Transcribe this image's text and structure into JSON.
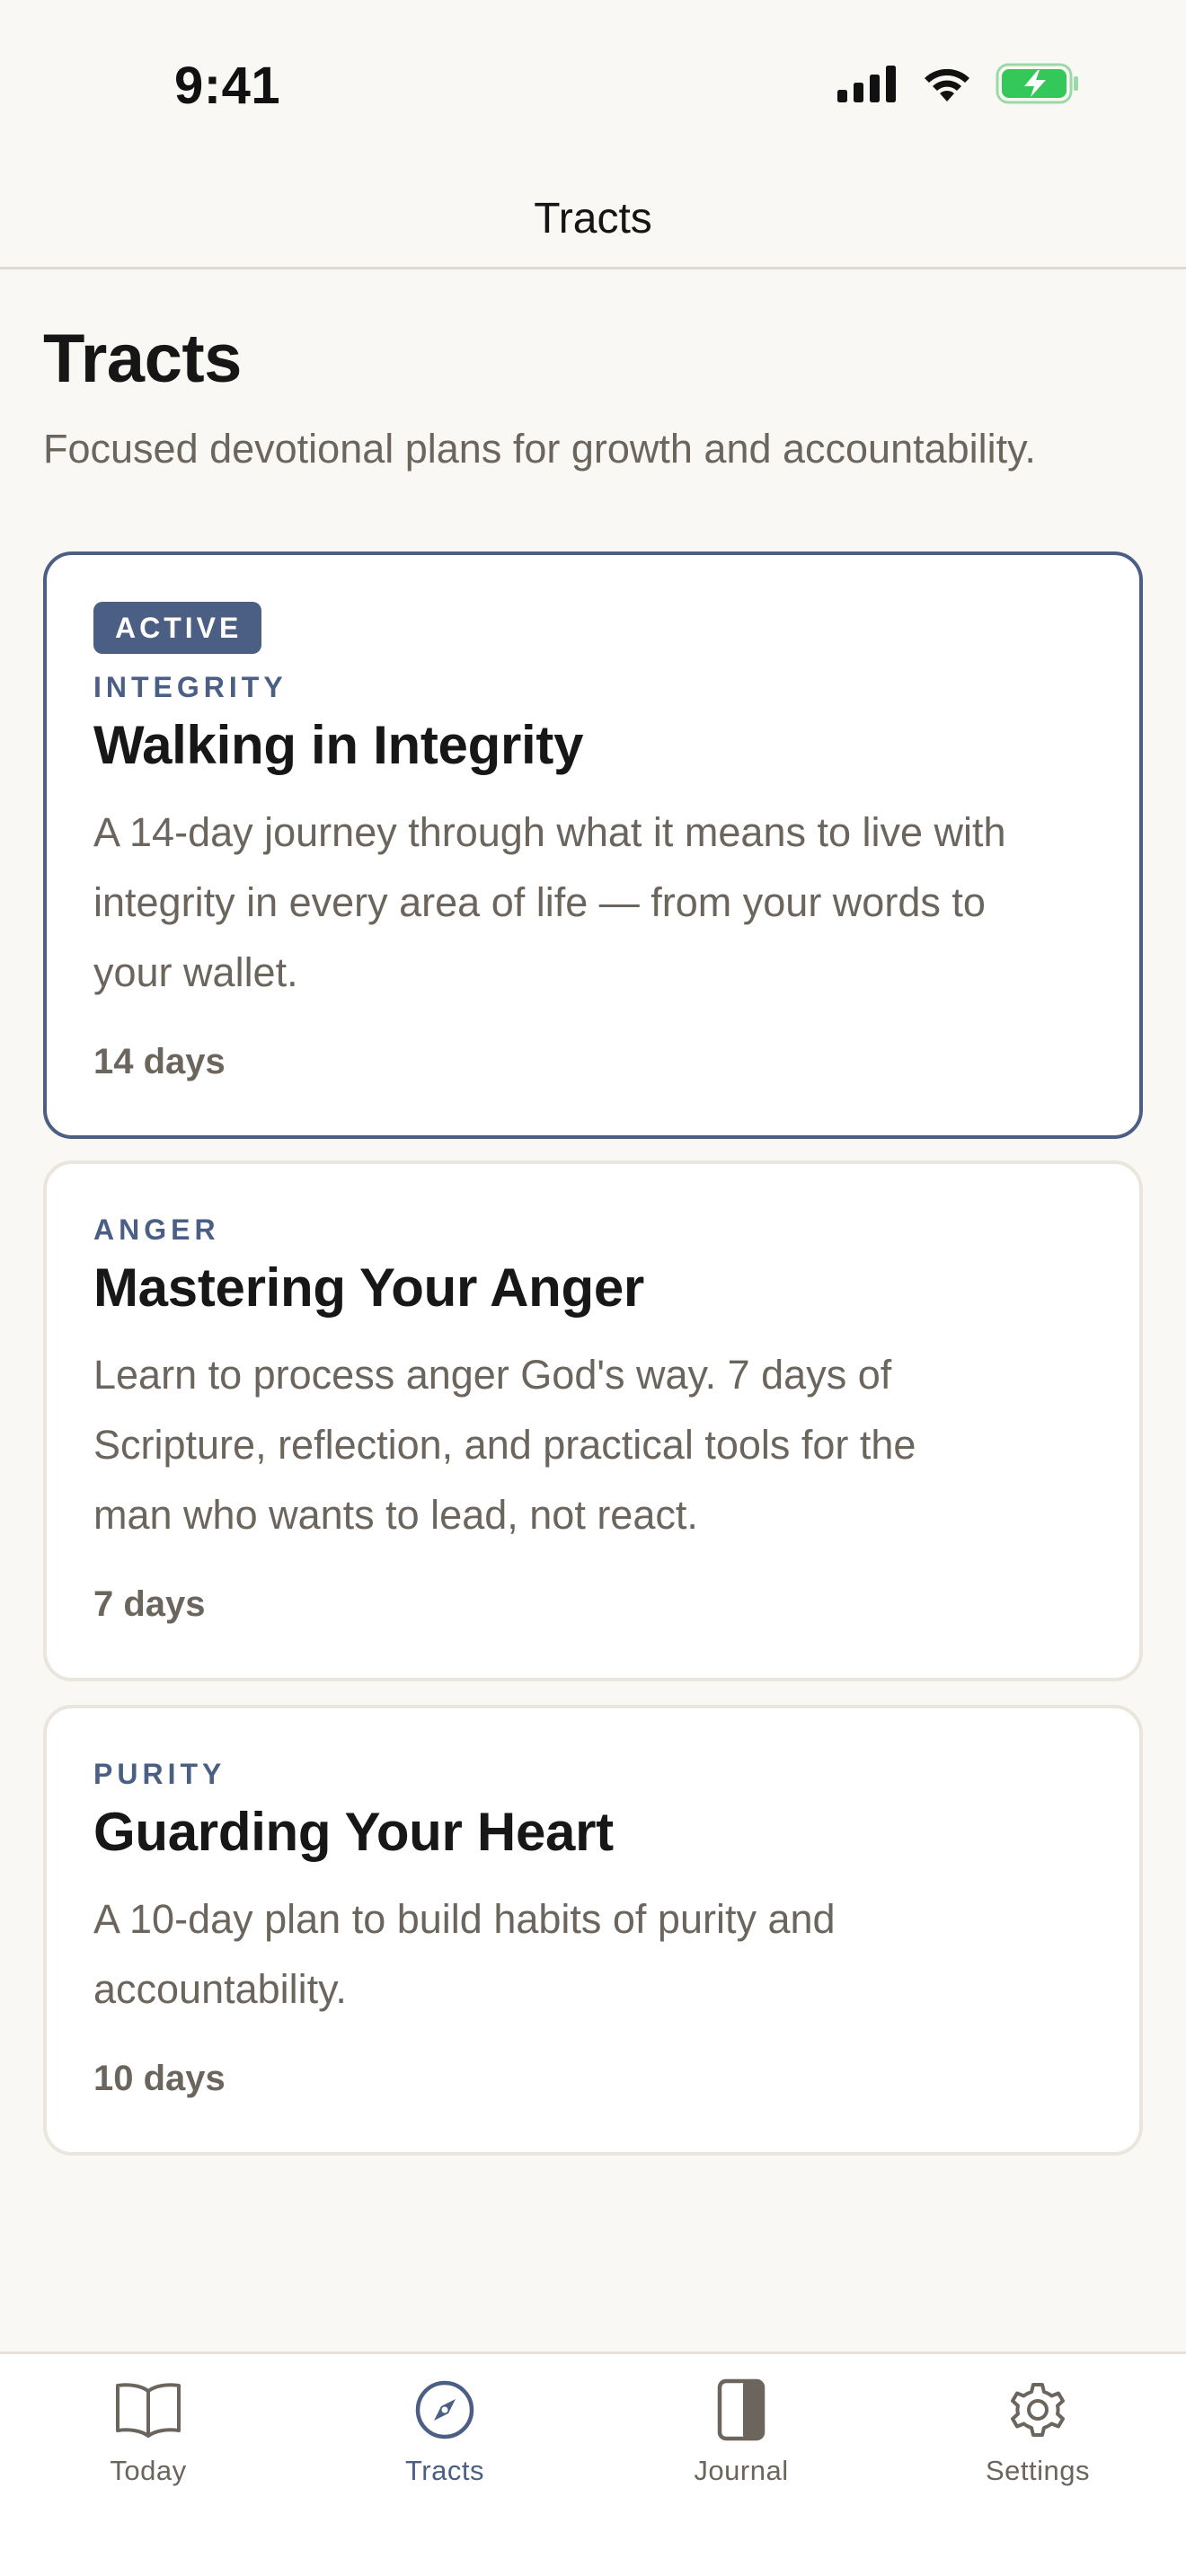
{
  "status_bar": {
    "time": "9:41"
  },
  "nav": {
    "title": "Tracts"
  },
  "header": {
    "title": "Tracts",
    "subtitle": "Focused devotional plans for growth and accountability."
  },
  "tracts": [
    {
      "badge": "ACTIVE",
      "category": "INTEGRITY",
      "title": "Walking in Integrity",
      "description_lines": [
        "A 14-day journey through what it means to live with",
        "integrity in every area of life — from your words to",
        "your wallet."
      ],
      "duration": "14 days"
    },
    {
      "category": "ANGER",
      "title": "Mastering Your Anger",
      "description_lines": [
        "Learn to process anger God's way. 7 days of",
        "Scripture, reflection, and practical tools for the",
        "man who wants to lead, not react."
      ],
      "duration": "7 days"
    },
    {
      "category": "PURITY",
      "title": "Guarding Your Heart",
      "description_lines": [
        "A 10-day plan to build habits of purity and",
        "accountability."
      ],
      "duration": "10 days"
    }
  ],
  "tab_bar": {
    "tabs": [
      {
        "label": "Today",
        "icon": "book-icon",
        "selected": false
      },
      {
        "label": "Tracts",
        "icon": "compass-icon",
        "selected": true
      },
      {
        "label": "Journal",
        "icon": "journal-icon",
        "selected": false
      },
      {
        "label": "Settings",
        "icon": "gear-icon",
        "selected": false
      }
    ]
  },
  "colors": {
    "background": "#f9f8f5",
    "accent": "#4b5f84",
    "muted_text": "#6b655d",
    "card_border": "#ebe6dd",
    "battery_green": "#34c759"
  }
}
